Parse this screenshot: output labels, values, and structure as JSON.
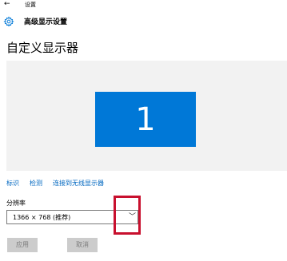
{
  "window": {
    "title": "设置",
    "back_icon": "back-arrow-icon"
  },
  "header": {
    "icon": "gear-icon",
    "title": "高级显示设置"
  },
  "page": {
    "title": "自定义显示器"
  },
  "display_preview": {
    "monitor_number": "1",
    "monitor_color": "#0078d7",
    "background_color": "#f2f2f2"
  },
  "links": {
    "identify": "标识",
    "detect": "检测",
    "connect_wireless": "连接到无线显示器"
  },
  "resolution": {
    "label": "分辨率",
    "selected_value": "1366 × 768 (推荐)",
    "dropdown_icon": "chevron-down-icon"
  },
  "buttons": {
    "apply": "应用",
    "cancel": "取消"
  },
  "colors": {
    "accent": "#0078d7",
    "link": "#0067c0",
    "highlight": "#c8102e",
    "button_disabled_bg": "#cccccc",
    "button_disabled_text": "#7d7d7d"
  }
}
